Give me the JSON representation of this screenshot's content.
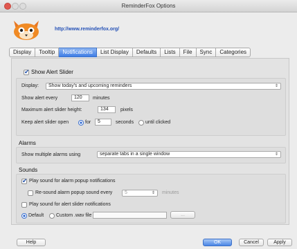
{
  "window": {
    "title": "ReminderFox Options"
  },
  "header": {
    "url": "http://www.reminderfox.org/"
  },
  "tabs": [
    {
      "label": "Display"
    },
    {
      "label": "Tooltip"
    },
    {
      "label": "Notifications"
    },
    {
      "label": "List Display"
    },
    {
      "label": "Defaults"
    },
    {
      "label": "Lists"
    },
    {
      "label": "File"
    },
    {
      "label": "Sync"
    },
    {
      "label": "Categories"
    }
  ],
  "alert_slider": {
    "show_label": "Show Alert Slider",
    "display_label": "Display:",
    "display_value": "Show today's and upcoming reminders",
    "show_every_label": "Show alert every",
    "show_every_value": "120",
    "minutes_label": "minutes",
    "max_height_label": "Maximum alert slider height:",
    "max_height_value": "134",
    "pixels_label": "pixels",
    "keep_open_label": "Keep alert slider open",
    "for_label": "for",
    "for_value": "5",
    "seconds_label": "seconds",
    "until_clicked_label": "until clicked"
  },
  "alarms": {
    "section_label": "Alarms",
    "show_multiple_label": "Show multiple alarms using",
    "show_multiple_value": "separate tabs in a single window"
  },
  "sounds": {
    "section_label": "Sounds",
    "play_alarm_label": "Play sound for alarm popup notifications",
    "resound_label": "Re-sound alarm popup sound every",
    "resound_value": "5",
    "resound_minutes": "minutes",
    "play_slider_label": "Play sound for alert slider notifications",
    "default_label": "Default",
    "custom_label": "Custom .wav file",
    "browse_label": "..."
  },
  "footer": {
    "help": "Help",
    "ok": "OK",
    "cancel": "Cancel",
    "apply": "Apply"
  }
}
